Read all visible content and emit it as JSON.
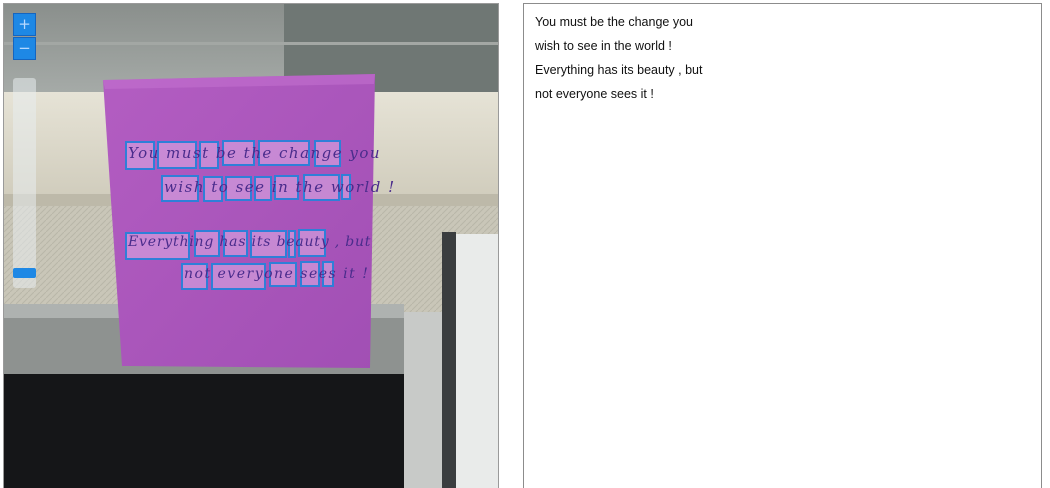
{
  "viewer": {
    "zoom_in_label": "+",
    "zoom_out_label": "−",
    "zoom_level": 0.05,
    "photo_handwriting": [
      "You must be the change you",
      "wish to see in the world !",
      "Everything has its beauty , but",
      "not everyone sees it !"
    ]
  },
  "ocr_text": {
    "lines": [
      "You must be the change you",
      "wish to see in the world !",
      "Everything has its beauty , but",
      "not everyone sees it !"
    ]
  },
  "colors": {
    "accent": "#1e88e5",
    "box_border": "#2f7fd8",
    "note": "#b55cc4",
    "panel_border": "#8c8c8c"
  }
}
